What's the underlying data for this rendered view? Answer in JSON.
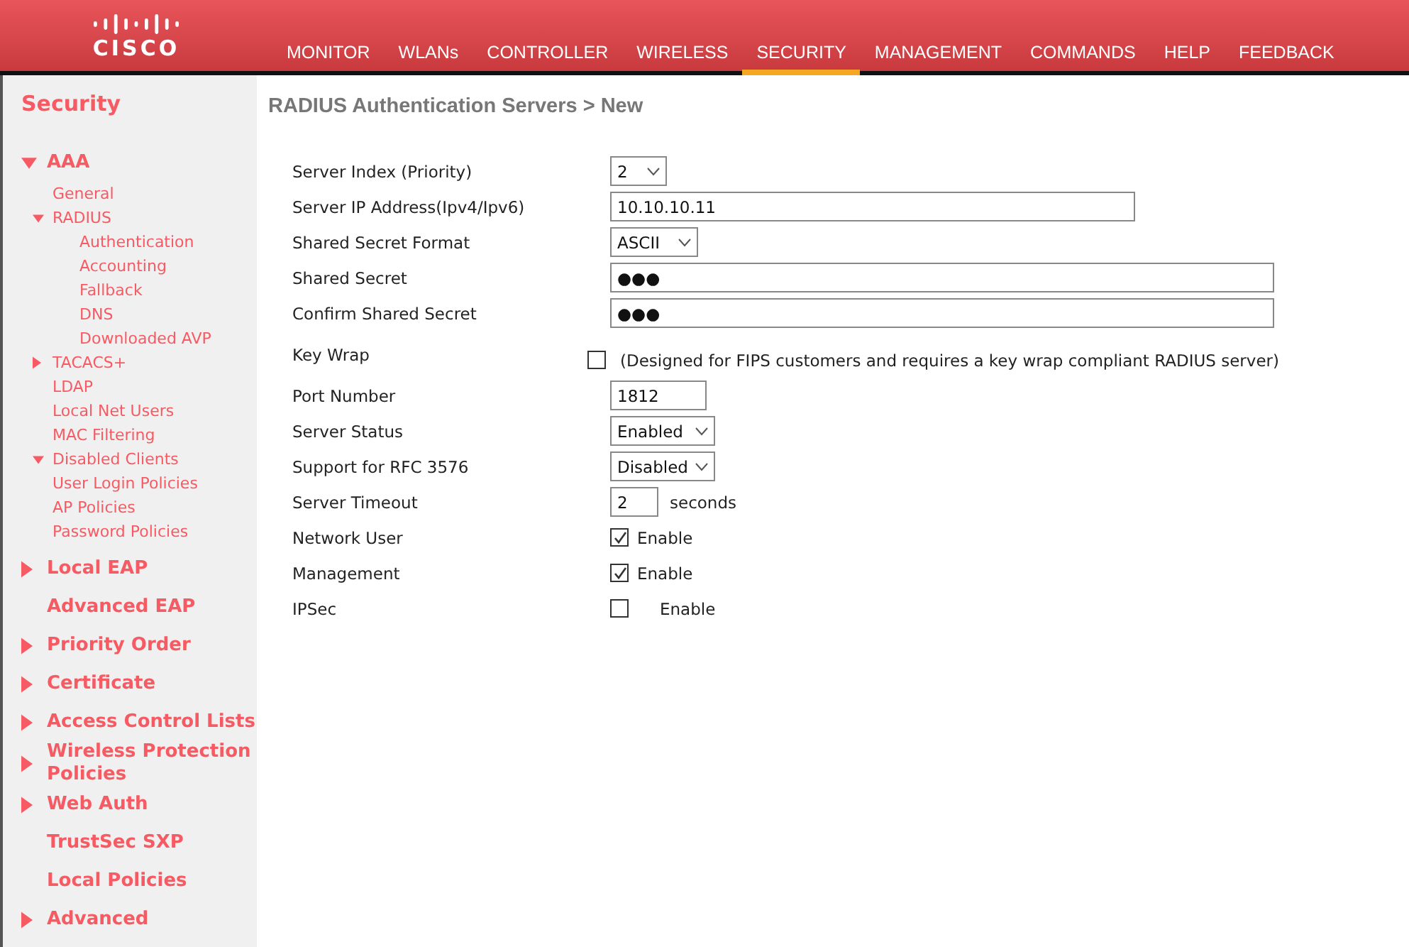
{
  "header": {
    "logo_text": "CISCO",
    "menu": [
      {
        "label": "MONITOR",
        "selected": false
      },
      {
        "label": "WLANs",
        "selected": false
      },
      {
        "label": "CONTROLLER",
        "selected": false
      },
      {
        "label": "WIRELESS",
        "selected": false
      },
      {
        "label": "SECURITY",
        "selected": true
      },
      {
        "label": "MANAGEMENT",
        "selected": false
      },
      {
        "label": "COMMANDS",
        "selected": false
      },
      {
        "label": "HELP",
        "selected": false
      },
      {
        "label": "FEEDBACK",
        "selected": false
      }
    ]
  },
  "sidebar": {
    "title": "Security",
    "items": [
      {
        "label": "AAA",
        "expanded": true,
        "children": [
          {
            "label": "General"
          },
          {
            "label": "RADIUS",
            "expanded": true,
            "children": [
              {
                "label": "Authentication"
              },
              {
                "label": "Accounting"
              },
              {
                "label": "Fallback"
              },
              {
                "label": "DNS"
              },
              {
                "label": "Downloaded AVP"
              }
            ]
          },
          {
            "label": "TACACS+",
            "expanded": false
          },
          {
            "label": "LDAP"
          },
          {
            "label": "Local Net Users"
          },
          {
            "label": "MAC Filtering"
          },
          {
            "label": "Disabled Clients",
            "expanded": true
          },
          {
            "label": "User Login Policies"
          },
          {
            "label": "AP Policies"
          },
          {
            "label": "Password Policies"
          }
        ]
      },
      {
        "label": "Local EAP",
        "expanded": false
      },
      {
        "label": "Advanced EAP"
      },
      {
        "label": "Priority Order",
        "expanded": false
      },
      {
        "label": "Certificate",
        "expanded": false
      },
      {
        "label": "Access Control Lists",
        "expanded": false
      },
      {
        "label": "Wireless Protection Policies",
        "expanded": false
      },
      {
        "label": "Web Auth",
        "expanded": false
      },
      {
        "label": "TrustSec SXP"
      },
      {
        "label": "Local Policies"
      },
      {
        "label": "Advanced",
        "expanded": false
      }
    ]
  },
  "page": {
    "title": "RADIUS Authentication Servers > New",
    "fields": [
      {
        "kind": "select",
        "label": "Server Index (Priority)",
        "value": "2"
      },
      {
        "kind": "text",
        "label": "Server IP Address(Ipv4/Ipv6)",
        "value": "10.10.10.11"
      },
      {
        "kind": "select",
        "label": "Shared Secret Format",
        "value": "ASCII"
      },
      {
        "kind": "text",
        "label": "Shared Secret",
        "value": "●●●"
      },
      {
        "kind": "text",
        "label": "Confirm Shared Secret",
        "value": "●●●"
      },
      {
        "kind": "note_check",
        "label": "Key Wrap",
        "checked": false,
        "note": "(Designed for FIPS customers and requires a key wrap compliant RADIUS server)"
      },
      {
        "kind": "text",
        "label": "Port Number",
        "value": "1812"
      },
      {
        "kind": "select",
        "label": "Server Status",
        "value": "Enabled"
      },
      {
        "kind": "select",
        "label": "Support for RFC 3576",
        "value": "Disabled"
      },
      {
        "kind": "text",
        "label": "Server Timeout",
        "value": "2",
        "suffix": "seconds"
      },
      {
        "kind": "check",
        "label": "Network User",
        "checked": true,
        "text": "Enable"
      },
      {
        "kind": "check",
        "label": "Management",
        "checked": true,
        "text": "Enable"
      },
      {
        "kind": "check",
        "label": "IPSec",
        "checked": false,
        "text": "Enable"
      }
    ]
  }
}
